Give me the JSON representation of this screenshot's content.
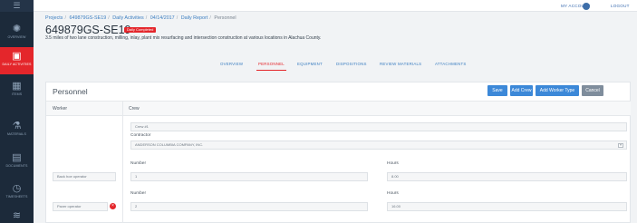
{
  "sidebar": {
    "menu_icon": "☰",
    "items": [
      {
        "label": "OVERVIEW",
        "icon": "gauge-icon",
        "glyph": "✺"
      },
      {
        "label": "DAILY ACTIVITIES",
        "icon": "calendar-icon",
        "glyph": "▣"
      },
      {
        "label": "ITEMS",
        "icon": "grid-icon",
        "glyph": "▦"
      },
      {
        "label": "MATERIALS",
        "icon": "flask-icon",
        "glyph": "⚗"
      },
      {
        "label": "DOCUMENTS",
        "icon": "document-icon",
        "glyph": "▤"
      },
      {
        "label": "TIMESHEETS",
        "icon": "clock-icon",
        "glyph": "◷"
      },
      {
        "label": "",
        "icon": "chart-icon",
        "glyph": "≋"
      }
    ]
  },
  "topbar": {
    "account": "MY ACCOUNT",
    "logout": "LOGOUT"
  },
  "breadcrumb": {
    "items": [
      "Projects",
      "649879GS-SE19",
      "Daily Activities",
      "04/14/2017",
      "Daily Report"
    ],
    "current": "Personnel"
  },
  "header": {
    "title": "649879GS-SE19",
    "badge": "Daily Completed",
    "subtitle": "3.5 miles of two lane construction, milling, inlay, plant mix resurfacing and intersection construction at various locations in Alachua County."
  },
  "tabs": [
    "OVERVIEW",
    "PERSONNEL",
    "EQUIPMENT",
    "DISPOSITIONS",
    "REVIEW MATERIALS",
    "ATTACHMENTS"
  ],
  "panel": {
    "title": "Personnel",
    "buttons": {
      "save": "Save",
      "add_crew": "Add Crew",
      "add_worker_type": "Add Worker Type",
      "cancel": "Cancel"
    },
    "columns": {
      "worker": "Worker",
      "crew": "Crew"
    },
    "crew": {
      "name": "Crew #1",
      "contractor_label": "Contractor",
      "contractor_value": "ANDERSON COLUMBIA COMPANY, INC."
    },
    "rows": [
      {
        "worker": "Back hoe operator",
        "number_label": "Number",
        "number": "1",
        "hours_label": "Hours",
        "hours": "8.00"
      },
      {
        "worker": "Paver operator",
        "number_label": "Number",
        "number": "2",
        "hours_label": "Hours",
        "hours": "16.00"
      }
    ]
  },
  "colors": {
    "sidebar_bg": "#1c2a3a",
    "accent_red": "#e4262b",
    "link_blue": "#3d7fc1",
    "button_blue": "#3c88d8",
    "button_gray": "#7f8d9c"
  }
}
